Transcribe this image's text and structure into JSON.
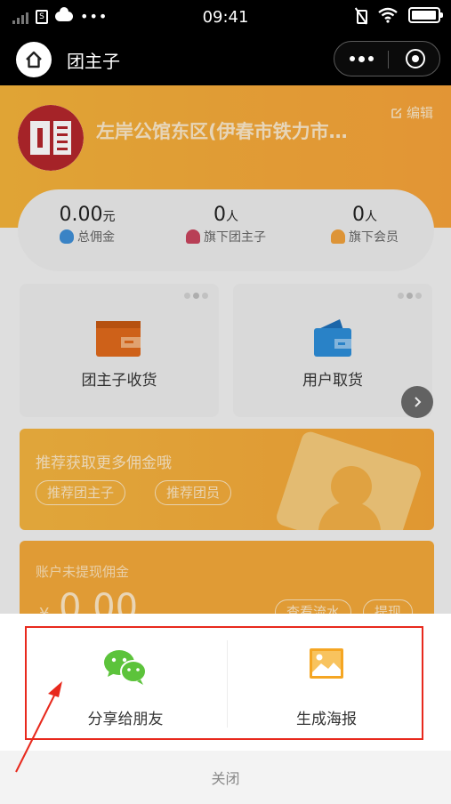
{
  "status_bar": {
    "time": "09:41",
    "icons": [
      "signal-icon",
      "sim-icon",
      "cloud-icon",
      "more-dots-icon",
      "mute-icon",
      "wifi-icon",
      "battery-icon"
    ]
  },
  "nav": {
    "title": "团主子",
    "icons": [
      "home-icon",
      "more-icon",
      "close-miniprogram-icon"
    ]
  },
  "store": {
    "name": "左岸公馆东区(伊春市铁力市…",
    "edit_label": "编辑"
  },
  "stats": [
    {
      "value": "0.00",
      "unit": "元",
      "label": "总佣金",
      "icon": "money-bag-icon",
      "color": "#3f8fd6"
    },
    {
      "value": "0",
      "unit": "人",
      "label": "旗下团主子",
      "icon": "person-icon",
      "color": "#c8455e"
    },
    {
      "value": "0",
      "unit": "人",
      "label": "旗下会员",
      "icon": "members-icon",
      "color": "#f0a13c"
    }
  ],
  "menu": [
    {
      "label": "团主子收货",
      "icon": "wallet-icon",
      "color": "#e06a1c"
    },
    {
      "label": "用户取货",
      "icon": "wallet-icon",
      "color": "#2d8ed8"
    }
  ],
  "promo": {
    "title": "推荐获取更多佣金哦",
    "buttons": [
      "推荐团主子",
      "推荐团员"
    ]
  },
  "commission": {
    "title": "账户未提现佣金",
    "currency": "¥",
    "amount": "0.00",
    "buttons": [
      "查看流水",
      "提现"
    ]
  },
  "share_sheet": {
    "options": [
      {
        "label": "分享给朋友",
        "icon": "wechat-icon",
        "color": "#5cc33b"
      },
      {
        "label": "生成海报",
        "icon": "image-icon",
        "color": "#f5a623"
      }
    ],
    "close_label": "关闭"
  },
  "colors": {
    "accent": "#f4a93a",
    "highlight": "#e8291d",
    "annotation_arrow": "#e8291d"
  }
}
